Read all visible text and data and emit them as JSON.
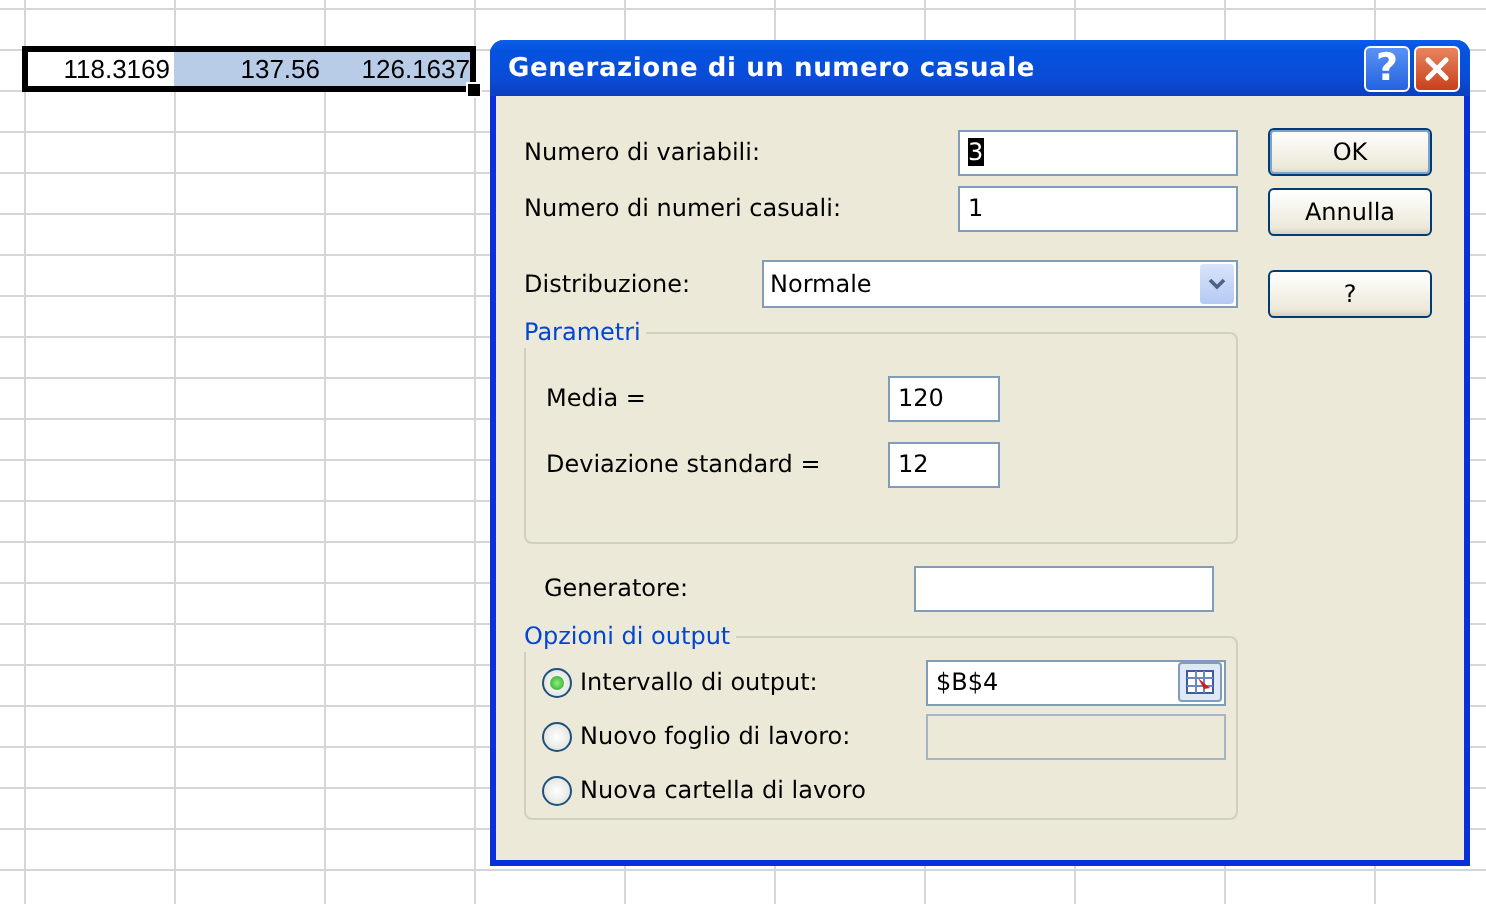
{
  "sheet": {
    "cells": [
      {
        "value": "118.3169",
        "highlighted": false
      },
      {
        "value": "137.56",
        "highlighted": true
      },
      {
        "value": "126.1637",
        "highlighted": true
      }
    ]
  },
  "dialog": {
    "title": "Generazione di un numero casuale",
    "help_glyph": "?",
    "fields": [
      {
        "label": "Numero di variabili:",
        "value": "3",
        "text_selected": true
      },
      {
        "label": "Numero di numeri casuali:",
        "value": "1",
        "text_selected": false
      }
    ],
    "distribution": {
      "label": "Distribuzione:",
      "value": "Normale"
    },
    "parameters": {
      "title": "Parametri",
      "fields": [
        {
          "label": "Media =",
          "value": "120"
        },
        {
          "label": "Deviazione standard =",
          "value": "12"
        }
      ]
    },
    "generator": {
      "label": "Generatore:"
    },
    "output": {
      "title": "Opzioni di output",
      "options": [
        {
          "label": "Intervallo di output:",
          "selected": true,
          "field": {
            "value": "$B$4",
            "disabled": false,
            "picker": true
          }
        },
        {
          "label": "Nuovo foglio di lavoro:",
          "selected": false,
          "field": {
            "disabled": true,
            "picker": false
          }
        },
        {
          "label": "Nuova cartella di lavoro",
          "selected": false
        }
      ]
    },
    "buttons": [
      "OK",
      "Annulla",
      "?"
    ]
  }
}
